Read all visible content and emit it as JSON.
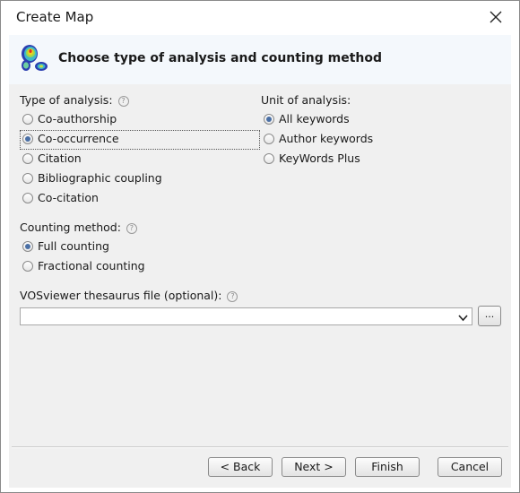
{
  "window": {
    "title": "Create Map"
  },
  "header": {
    "heading": "Choose type of analysis and counting method"
  },
  "analysis_type": {
    "label": "Type of analysis:",
    "options": [
      "Co-authorship",
      "Co-occurrence",
      "Citation",
      "Bibliographic coupling",
      "Co-citation"
    ],
    "selected": "Co-occurrence"
  },
  "unit": {
    "label": "Unit of analysis:",
    "options": [
      "All keywords",
      "Author keywords",
      "KeyWords Plus"
    ],
    "selected": "All keywords"
  },
  "counting": {
    "label": "Counting method:",
    "options": [
      "Full counting",
      "Fractional counting"
    ],
    "selected": "Full counting"
  },
  "thesaurus": {
    "label": "VOSviewer thesaurus file (optional):",
    "value": "",
    "browse_label": "..."
  },
  "help_symbol": "?",
  "buttons": {
    "back": "< Back",
    "next": "Next >",
    "finish": "Finish",
    "cancel": "Cancel"
  },
  "colors": {
    "accent": "#4a6fa5",
    "header_bg": "#f4f8fc",
    "panel_bg": "#f0f0f0"
  },
  "icons": {
    "close": "close-icon",
    "logo": "vosviewer-logo-icon",
    "dropdown": "chevron-down-icon"
  }
}
